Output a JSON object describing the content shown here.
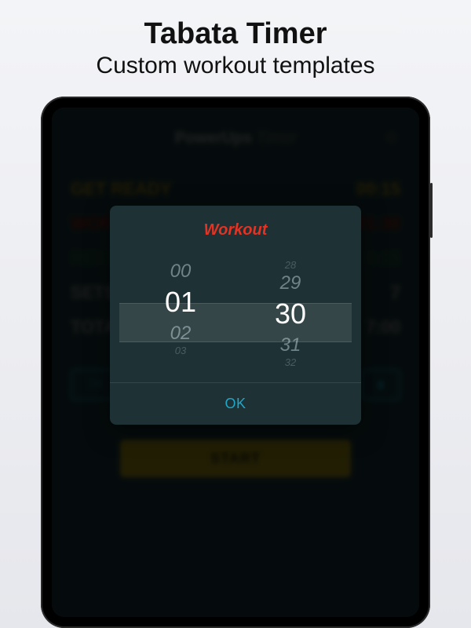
{
  "promo": {
    "title": "Tabata Timer",
    "subtitle": "Custom workout templates"
  },
  "app": {
    "brand_bold": "PowerUps",
    "brand_thin": "Timer"
  },
  "rows": [
    {
      "label": "GET READY",
      "value": "00:15",
      "cls": "c-yellow"
    },
    {
      "label": "WORKOUT",
      "value": "01:30",
      "cls": "c-red"
    },
    {
      "label": "REST",
      "value": "0:15",
      "cls": "c-green"
    },
    {
      "label": "SETS",
      "value": "7",
      "cls": "c-white"
    },
    {
      "label": "TOTAL",
      "value": "7:00",
      "cls": "c-white"
    }
  ],
  "chip_a": "74",
  "start_label": "START",
  "dialog": {
    "title": "Workout",
    "ok": "OK",
    "minute_wheel": {
      "above2": "",
      "above": "00",
      "selected": "01",
      "below": "02",
      "below2": "03"
    },
    "second_wheel": {
      "above2": "28",
      "above": "29",
      "selected": "30",
      "below": "31",
      "below2": "32"
    }
  }
}
